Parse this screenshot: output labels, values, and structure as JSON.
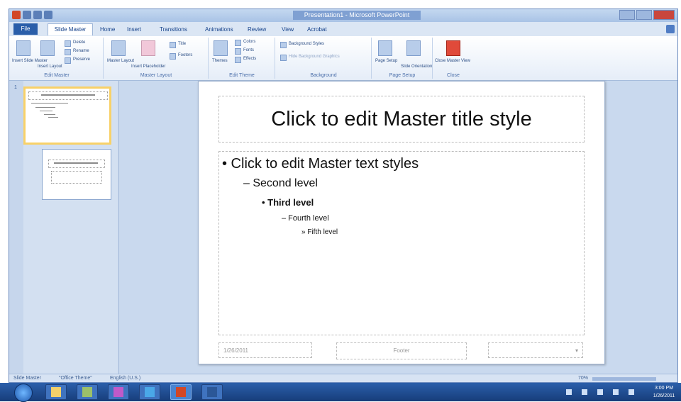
{
  "window": {
    "title": "Presentation1 - Microsoft PowerPoint"
  },
  "ribbon": {
    "tabs": [
      {
        "label": "File"
      },
      {
        "label": "Slide Master"
      },
      {
        "label": "Home"
      },
      {
        "label": "Insert"
      },
      {
        "label": "Transitions"
      },
      {
        "label": "Animations"
      },
      {
        "label": "Review"
      },
      {
        "label": "View"
      },
      {
        "label": "Acrobat"
      }
    ],
    "groups": [
      {
        "label": "Edit Master",
        "buttons": [
          "Insert Slide Master",
          "Insert Layout",
          "Delete",
          "Rename",
          "Preserve"
        ]
      },
      {
        "label": "Master Layout",
        "buttons": [
          "Master Layout",
          "Insert Placeholder",
          "Title",
          "Footers"
        ]
      },
      {
        "label": "Edit Theme",
        "buttons": [
          "Themes",
          "Colors",
          "Fonts",
          "Effects"
        ]
      },
      {
        "label": "Background",
        "buttons": [
          "Background Styles",
          "Hide Background Graphics"
        ]
      },
      {
        "label": "Page Setup",
        "buttons": [
          "Page Setup",
          "Slide Orientation"
        ]
      },
      {
        "label": "Close",
        "buttons": [
          "Close Master View"
        ]
      }
    ]
  },
  "slide": {
    "title": "Click to edit Master title style",
    "levels": [
      "• Click to edit Master text styles",
      "– Second level",
      "• Third level",
      "– Fourth level",
      "» Fifth level"
    ],
    "footer": {
      "date": "1/26/2011",
      "text": "Footer"
    }
  },
  "thumbnails": {
    "number": "1"
  },
  "statusbar": {
    "view": "Slide Master",
    "theme": "\"Office Theme\"",
    "language": "English (U.S.)",
    "zoom": "70%"
  },
  "taskbar": {
    "clock_time": "3:00 PM",
    "clock_date": "1/26/2011"
  },
  "colors": {
    "accent": "#2a5ea9",
    "file_tab": "#2a5ea9",
    "thumb_selected": "#f8d168"
  }
}
